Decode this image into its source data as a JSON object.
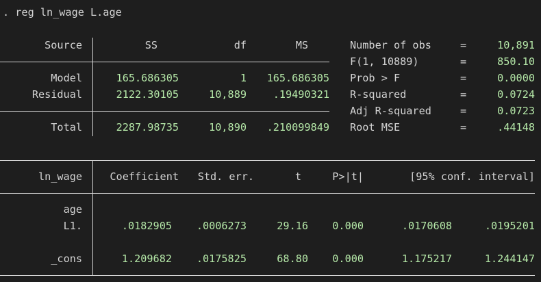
{
  "command": ". reg ln_wage L.age",
  "anova": {
    "headers": {
      "source": "Source",
      "ss": "SS",
      "df": "df",
      "ms": "MS"
    },
    "rows": [
      {
        "source": "Model",
        "ss": "165.686305",
        "df": "1",
        "ms": "165.686305"
      },
      {
        "source": "Residual",
        "ss": "2122.30105",
        "df": "10,889",
        "ms": ".19490321"
      }
    ],
    "total": {
      "source": "Total",
      "ss": "2287.98735",
      "df": "10,890",
      "ms": ".210099849"
    }
  },
  "stats": [
    {
      "label": "Number of obs",
      "eq": "=",
      "value": "10,891"
    },
    {
      "label": "F(1, 10889)",
      "eq": "=",
      "value": "850.10"
    },
    {
      "label": "Prob > F",
      "eq": "=",
      "value": "0.0000"
    },
    {
      "label": "R-squared",
      "eq": "=",
      "value": "0.0724"
    },
    {
      "label": "Adj R-squared",
      "eq": "=",
      "value": "0.0723"
    },
    {
      "label": "Root MSE",
      "eq": "=",
      "value": ".44148"
    }
  ],
  "coef": {
    "headers": {
      "var": "ln_wage",
      "coef": "Coefficient",
      "se": "Std. err.",
      "t": "t",
      "p": "P>|t|",
      "ci": "[95% conf. interval]"
    },
    "age_label": "age",
    "rows": [
      {
        "var": "L1.",
        "coef": ".0182905",
        "se": ".0006273",
        "t": "29.16",
        "p": "0.000",
        "lo": ".0170608",
        "hi": ".0195201"
      },
      {
        "var": "_cons",
        "coef": "1.209682",
        "se": ".0175825",
        "t": "68.80",
        "p": "0.000",
        "lo": "1.175217",
        "hi": "1.244147"
      }
    ]
  }
}
